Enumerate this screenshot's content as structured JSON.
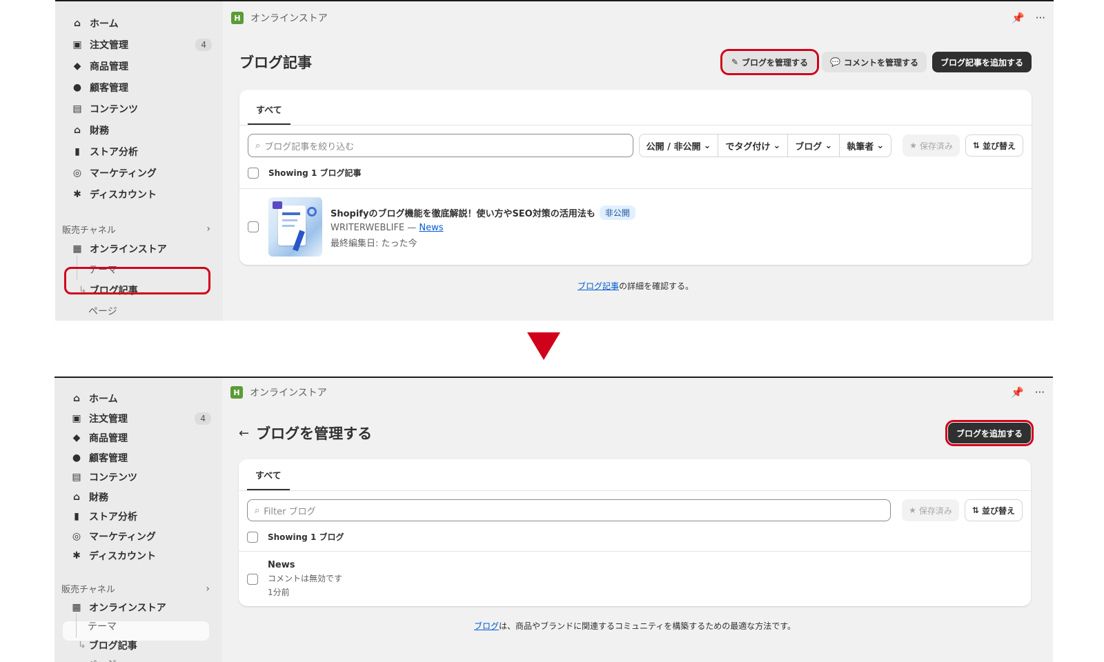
{
  "sidebar": {
    "items": [
      {
        "icon": "home-icon",
        "glyph": "⌂",
        "label": "ホーム"
      },
      {
        "icon": "inbox-icon",
        "glyph": "▣",
        "label": "注文管理",
        "badge": "4"
      },
      {
        "icon": "tag-icon",
        "glyph": "◆",
        "label": "商品管理"
      },
      {
        "icon": "person-icon",
        "glyph": "●",
        "label": "顧客管理"
      },
      {
        "icon": "content-icon",
        "glyph": "▤",
        "label": "コンテンツ"
      },
      {
        "icon": "bank-icon",
        "glyph": "⌂",
        "label": "財務"
      },
      {
        "icon": "analytics-icon",
        "glyph": "▮",
        "label": "ストア分析"
      },
      {
        "icon": "marketing-icon",
        "glyph": "◎",
        "label": "マーケティング"
      },
      {
        "icon": "discount-icon",
        "glyph": "✱",
        "label": "ディスカウント"
      }
    ],
    "channels_label": "販売チャネル",
    "online_store": "オンラインストア",
    "theme": "テーマ",
    "blog_posts": "ブログ記事",
    "pages": "ページ"
  },
  "topbar": {
    "store_name": "オンラインストア"
  },
  "screen1": {
    "title": "ブログ記事",
    "manage_blogs": "ブログを管理する",
    "manage_comments": "コメントを管理する",
    "add_post": "ブログ記事を追加する",
    "tab_all": "すべて",
    "search_placeholder": "ブログ記事を絞り込む",
    "filters": [
      "公開 / 非公開",
      "でタグ付け",
      "ブログ",
      "執筆者"
    ],
    "saved": "保存済み",
    "sort": "並び替え",
    "showing": "Showing 1 ブログ記事",
    "article": {
      "title": "Shopifyのブログ機能を徹底解説！使い方やSEO対策の活用法も",
      "status": "非公開",
      "author": "WRITERWEBLIFE —",
      "blog": "News",
      "edited": "最終編集日: たった今"
    },
    "footer_link": "ブログ記事",
    "footer_text": "の詳細を確認する。"
  },
  "screen2": {
    "title": "ブログを管理する",
    "add_blog": "ブログを追加する",
    "tab_all": "すべて",
    "search_placeholder": "Filter ブログ",
    "saved": "保存済み",
    "sort": "並び替え",
    "showing": "Showing 1 ブログ",
    "blog": {
      "name": "News",
      "comments": "コメントは無効です",
      "time": "1分前"
    },
    "footer_link": "ブログ",
    "footer_text": "は、商品やブランドに関連するコミュニティを構築するための最適な方法です。"
  },
  "colors": {
    "accent_red": "#d0021b",
    "link": "#005bd3",
    "primary_btn": "#303030"
  }
}
